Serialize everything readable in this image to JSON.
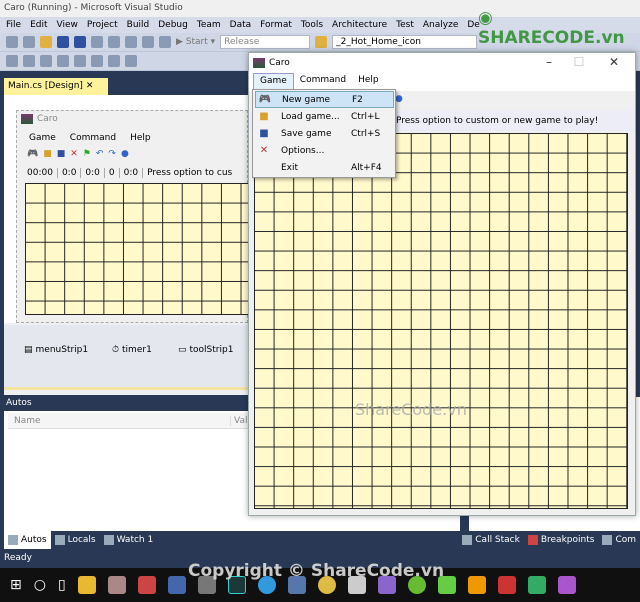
{
  "window": {
    "title": "Caro (Running) - Microsoft Visual Studio"
  },
  "menu": [
    "File",
    "Edit",
    "View",
    "Project",
    "Build",
    "Debug",
    "Team",
    "Data",
    "Format",
    "Tools",
    "Architecture",
    "Test",
    "Analyze",
    "De"
  ],
  "toolbar": {
    "start": "▶ Start ▾",
    "config": "Release",
    "startup_item": "_2_Hot_Home_icon"
  },
  "doc_tab": {
    "label": "Main.cs [Design]"
  },
  "designer": {
    "form_title": "Caro",
    "menu": [
      "Game",
      "Command",
      "Help"
    ],
    "status": [
      "00:00",
      "0:0",
      "0:0",
      "0",
      "0:0",
      "Press option to cus"
    ]
  },
  "tray": [
    "menuStrip1",
    "timer1",
    "toolStrip1"
  ],
  "autos": {
    "title": "Autos",
    "columns": [
      "Name",
      "Valu"
    ]
  },
  "bottom_tabs": [
    "Autos",
    "Locals",
    "Watch 1"
  ],
  "right_tabs": [
    "Call Stack",
    "Breakpoints",
    "Com"
  ],
  "status": "Ready",
  "caro": {
    "title": "Caro",
    "menu": [
      "Game",
      "Command",
      "Help"
    ],
    "status": "Press option to custom or new game to play!",
    "grid_color": "#fff9cc"
  },
  "dropdown": [
    {
      "icon": "gamepad-icon",
      "label": "New game",
      "shortcut": "F2"
    },
    {
      "icon": "folder-open-icon",
      "label": "Load game...",
      "shortcut": "Ctrl+L"
    },
    {
      "icon": "save-icon",
      "label": "Save game",
      "shortcut": "Ctrl+S"
    },
    {
      "icon": "options-icon",
      "label": "Options...",
      "shortcut": ""
    },
    {
      "icon": "exit-icon",
      "label": "Exit",
      "shortcut": "Alt+F4"
    }
  ],
  "watermarks": {
    "logo": "SHARECODE.vn",
    "center": "ShareCode.vn",
    "copyright": "Copyright © ShareCode.vn"
  }
}
